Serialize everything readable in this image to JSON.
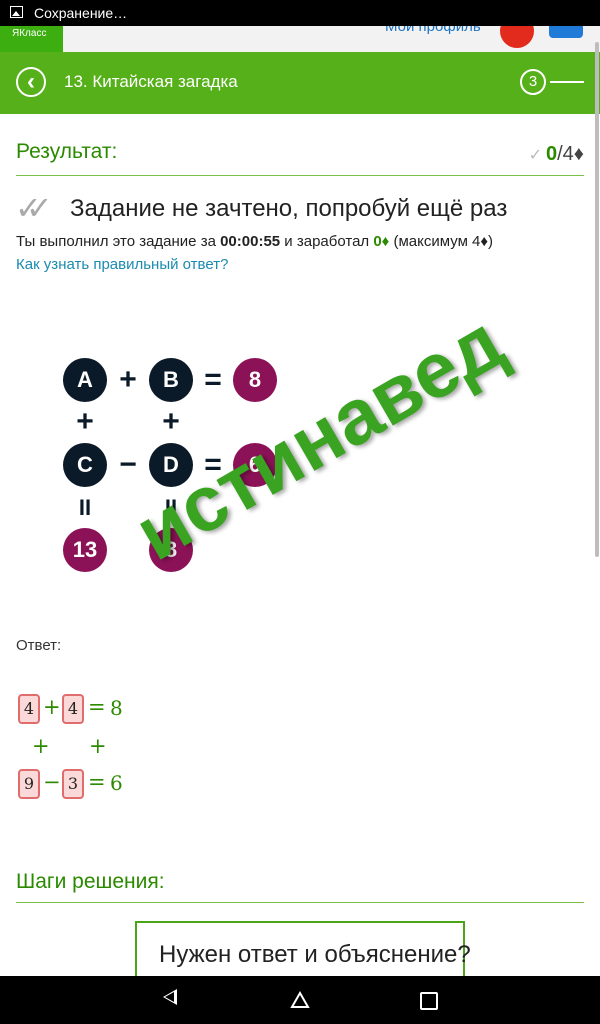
{
  "status_bar": {
    "text": "Сохранение…"
  },
  "top_strip": {
    "logo": "ЯКласс",
    "profile_link": "Мой профиль"
  },
  "header": {
    "title": "13. Китайская загадка",
    "step_number": "3"
  },
  "result": {
    "title": "Результат:",
    "score_earned": "0",
    "score_max": "/4♦",
    "fail_message": "Задание не зачтено, попробуй ещё раз",
    "info": {
      "prefix": "Ты выполнил это задание за ",
      "time": "00:00:55",
      "middle": " и заработал ",
      "earned": "0♦",
      "suffix": " (максимум 4♦)"
    },
    "help_link": "Как узнать правильный ответ?"
  },
  "puzzle": {
    "a": "A",
    "b": "B",
    "c": "C",
    "d": "D",
    "plus": "+",
    "minus": "−",
    "equals": "=",
    "parallel": "II",
    "sum_row1": "8",
    "diff_row2": "6",
    "sum_col1": "13",
    "sum_col2": "8"
  },
  "watermark": "истинавед",
  "answer": {
    "label": "Ответ:",
    "row1": {
      "box1": "4",
      "op": "+",
      "box2": "4",
      "eq": "=",
      "result": "8"
    },
    "mid_ops": {
      "left": "+",
      "right": "+"
    },
    "row2": {
      "box1": "9",
      "op": "−",
      "box2": "3",
      "eq": "=",
      "result": "6"
    }
  },
  "steps": {
    "title": "Шаги решения:"
  },
  "help_box": {
    "text": "Нужен ответ и объяснение?"
  },
  "colors": {
    "brand_green": "#56b01a",
    "text_green": "#2b8a00",
    "puzzle_dark": "#0b1a28",
    "puzzle_purple": "#8c1257",
    "link_blue": "#1a8bb0"
  }
}
